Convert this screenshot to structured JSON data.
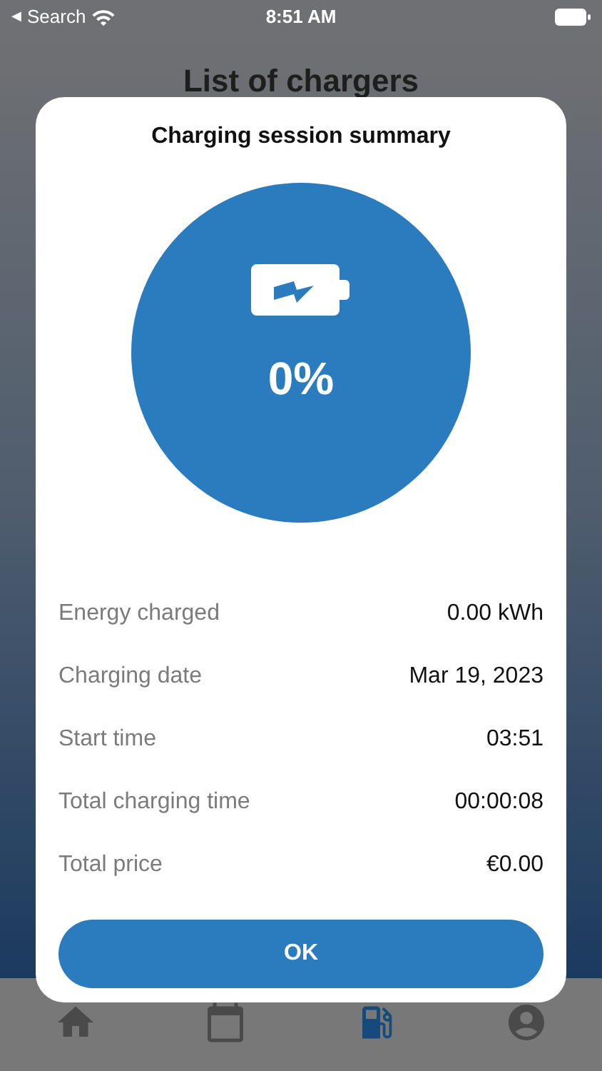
{
  "status_bar": {
    "back_arrow": "◀",
    "back_label": "Search",
    "time": "8:51 AM"
  },
  "page": {
    "title": "List of chargers"
  },
  "dialog": {
    "title": "Charging session summary",
    "percent": "0%",
    "rows": [
      {
        "label": "Energy charged",
        "value": "0.00 kWh"
      },
      {
        "label": "Charging date",
        "value": "Mar 19, 2023"
      },
      {
        "label": "Start time",
        "value": "03:51"
      },
      {
        "label": "Total charging time",
        "value": "00:00:08"
      },
      {
        "label": "Total price",
        "value": "€0.00"
      }
    ],
    "button": "OK"
  },
  "tab_bar": [
    {
      "kind": "home",
      "selected": false
    },
    {
      "kind": "calendar",
      "selected": false
    },
    {
      "kind": "fuel",
      "selected": true
    },
    {
      "kind": "account",
      "selected": false
    }
  ]
}
